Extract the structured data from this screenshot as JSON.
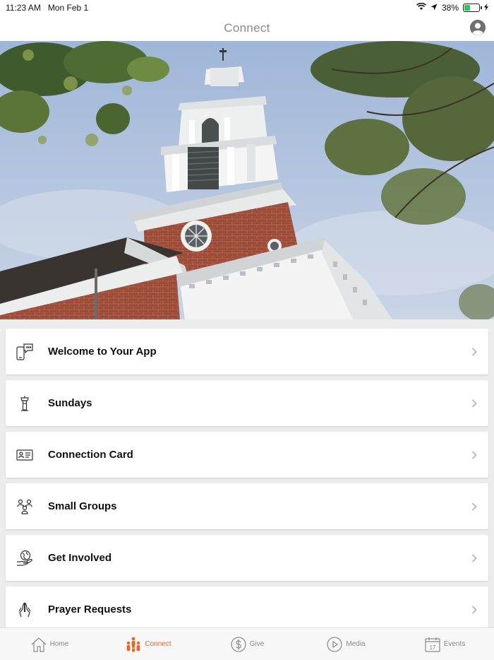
{
  "status_bar": {
    "time": "11:23 AM",
    "date": "Mon Feb 1",
    "battery": "38%",
    "battery_level": 0.38
  },
  "nav": {
    "title": "Connect"
  },
  "menu": {
    "items": [
      {
        "label": "Welcome to Your App",
        "icon": "phone-chat-icon"
      },
      {
        "label": "Sundays",
        "icon": "pulpit-icon"
      },
      {
        "label": "Connection Card",
        "icon": "id-card-icon"
      },
      {
        "label": "Small Groups",
        "icon": "group-icon"
      },
      {
        "label": "Get Involved",
        "icon": "globe-hand-icon"
      },
      {
        "label": "Prayer Requests",
        "icon": "praying-hands-icon"
      }
    ]
  },
  "tabs": [
    {
      "label": "Home",
      "icon": "home-icon"
    },
    {
      "label": "Connect",
      "icon": "people-icon"
    },
    {
      "label": "Give",
      "icon": "dollar-icon"
    },
    {
      "label": "Media",
      "icon": "play-icon"
    },
    {
      "label": "Events",
      "icon": "calendar-icon",
      "badge": "17"
    }
  ],
  "colors": {
    "accent": "#e8642b",
    "inactive": "#8a8a8a"
  }
}
